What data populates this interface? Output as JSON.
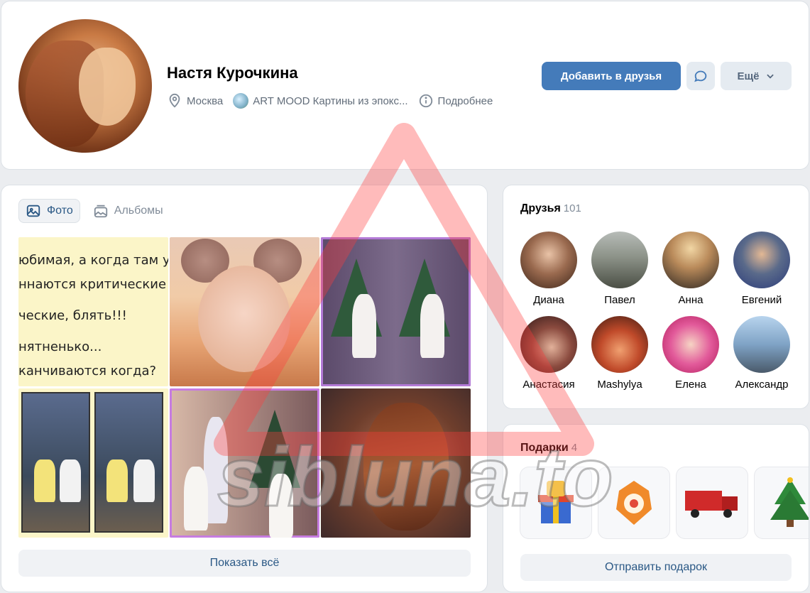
{
  "profile": {
    "name": "Настя Курочкина",
    "city": "Москва",
    "work": "ART MOOD Картины из эпокс...",
    "details_label": "Подробнее",
    "avatar_icon": "user-avatar"
  },
  "actions": {
    "add_friend_label": "Добавить в друзья",
    "message_icon": "message-icon",
    "more_label": "Ещё"
  },
  "photos": {
    "tabs": [
      {
        "label": "Фото",
        "icon": "photo-icon",
        "active": true
      },
      {
        "label": "Альбомы",
        "icon": "albums-icon",
        "active": false
      }
    ],
    "text_photo_lines": [
      "юбимая, а когда там у",
      "ннаются критические",
      "",
      "ческие, блять!!!",
      "",
      "нятненько...",
      "канчиваются когда?"
    ],
    "show_all_label": "Показать всё"
  },
  "friends": {
    "title": "Друзья",
    "count": "101",
    "items": [
      {
        "name": "Диана",
        "color": "#5a3a2a"
      },
      {
        "name": "Павел",
        "color": "#6f7a6a"
      },
      {
        "name": "Анна",
        "color": "#8a6a4a"
      },
      {
        "name": "Евгений",
        "color": "#3a4a8a"
      },
      {
        "name": "Анастасия",
        "color": "#4a2a2a"
      },
      {
        "name": "Mashylya",
        "color": "#c05a3a"
      },
      {
        "name": "Елена",
        "color": "#e04a8a"
      },
      {
        "name": "Александр",
        "color": "#6a8ab0"
      }
    ]
  },
  "gifts": {
    "title": "Подарки",
    "count": "4",
    "send_label": "Отправить подарок"
  },
  "watermark": {
    "text": "sibluna.to",
    "color": "#ff3b3b"
  }
}
